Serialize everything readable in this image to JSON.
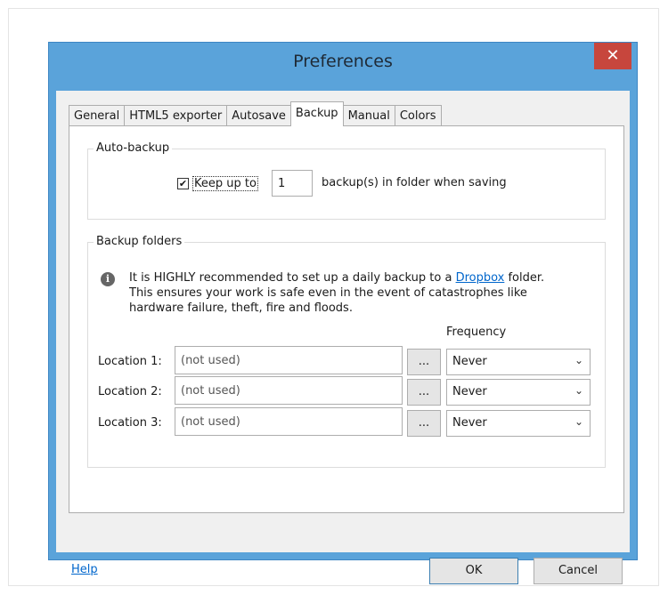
{
  "window": {
    "title": "Preferences",
    "close_glyph": "✕"
  },
  "tabs": [
    {
      "label": "General"
    },
    {
      "label": "HTML5 exporter"
    },
    {
      "label": "Autosave"
    },
    {
      "label": "Backup",
      "active": true
    },
    {
      "label": "Manual"
    },
    {
      "label": "Colors"
    }
  ],
  "auto_backup": {
    "title": "Auto-backup",
    "keep_checked": true,
    "keep_label": "Keep up to",
    "count_value": "1",
    "suffix": "backup(s) in folder when saving"
  },
  "backup_folders": {
    "title": "Backup folders",
    "info_icon": "info-icon",
    "info_line1_pre": "It is HIGHLY recommended to set up a daily backup to a ",
    "info_link": "Dropbox",
    "info_line1_post": " folder.",
    "info_line2": "This ensures your work is safe even in the event of catastrophes like",
    "info_line3": "hardware failure, theft, fire and floods.",
    "frequency_header": "Frequency",
    "locations": [
      {
        "label": "Location 1:",
        "placeholder": "(not used)",
        "browse": "...",
        "frequency": "Never"
      },
      {
        "label": "Location 2:",
        "placeholder": "(not used)",
        "browse": "...",
        "frequency": "Never"
      },
      {
        "label": "Location 3:",
        "placeholder": "(not used)",
        "browse": "...",
        "frequency": "Never"
      }
    ]
  },
  "footer": {
    "help_label": "Help",
    "ok_label": "OK",
    "cancel_label": "Cancel"
  },
  "colors": {
    "title_bar": "#5aa3da",
    "close_button": "#c7463d",
    "link": "#0066cc"
  }
}
